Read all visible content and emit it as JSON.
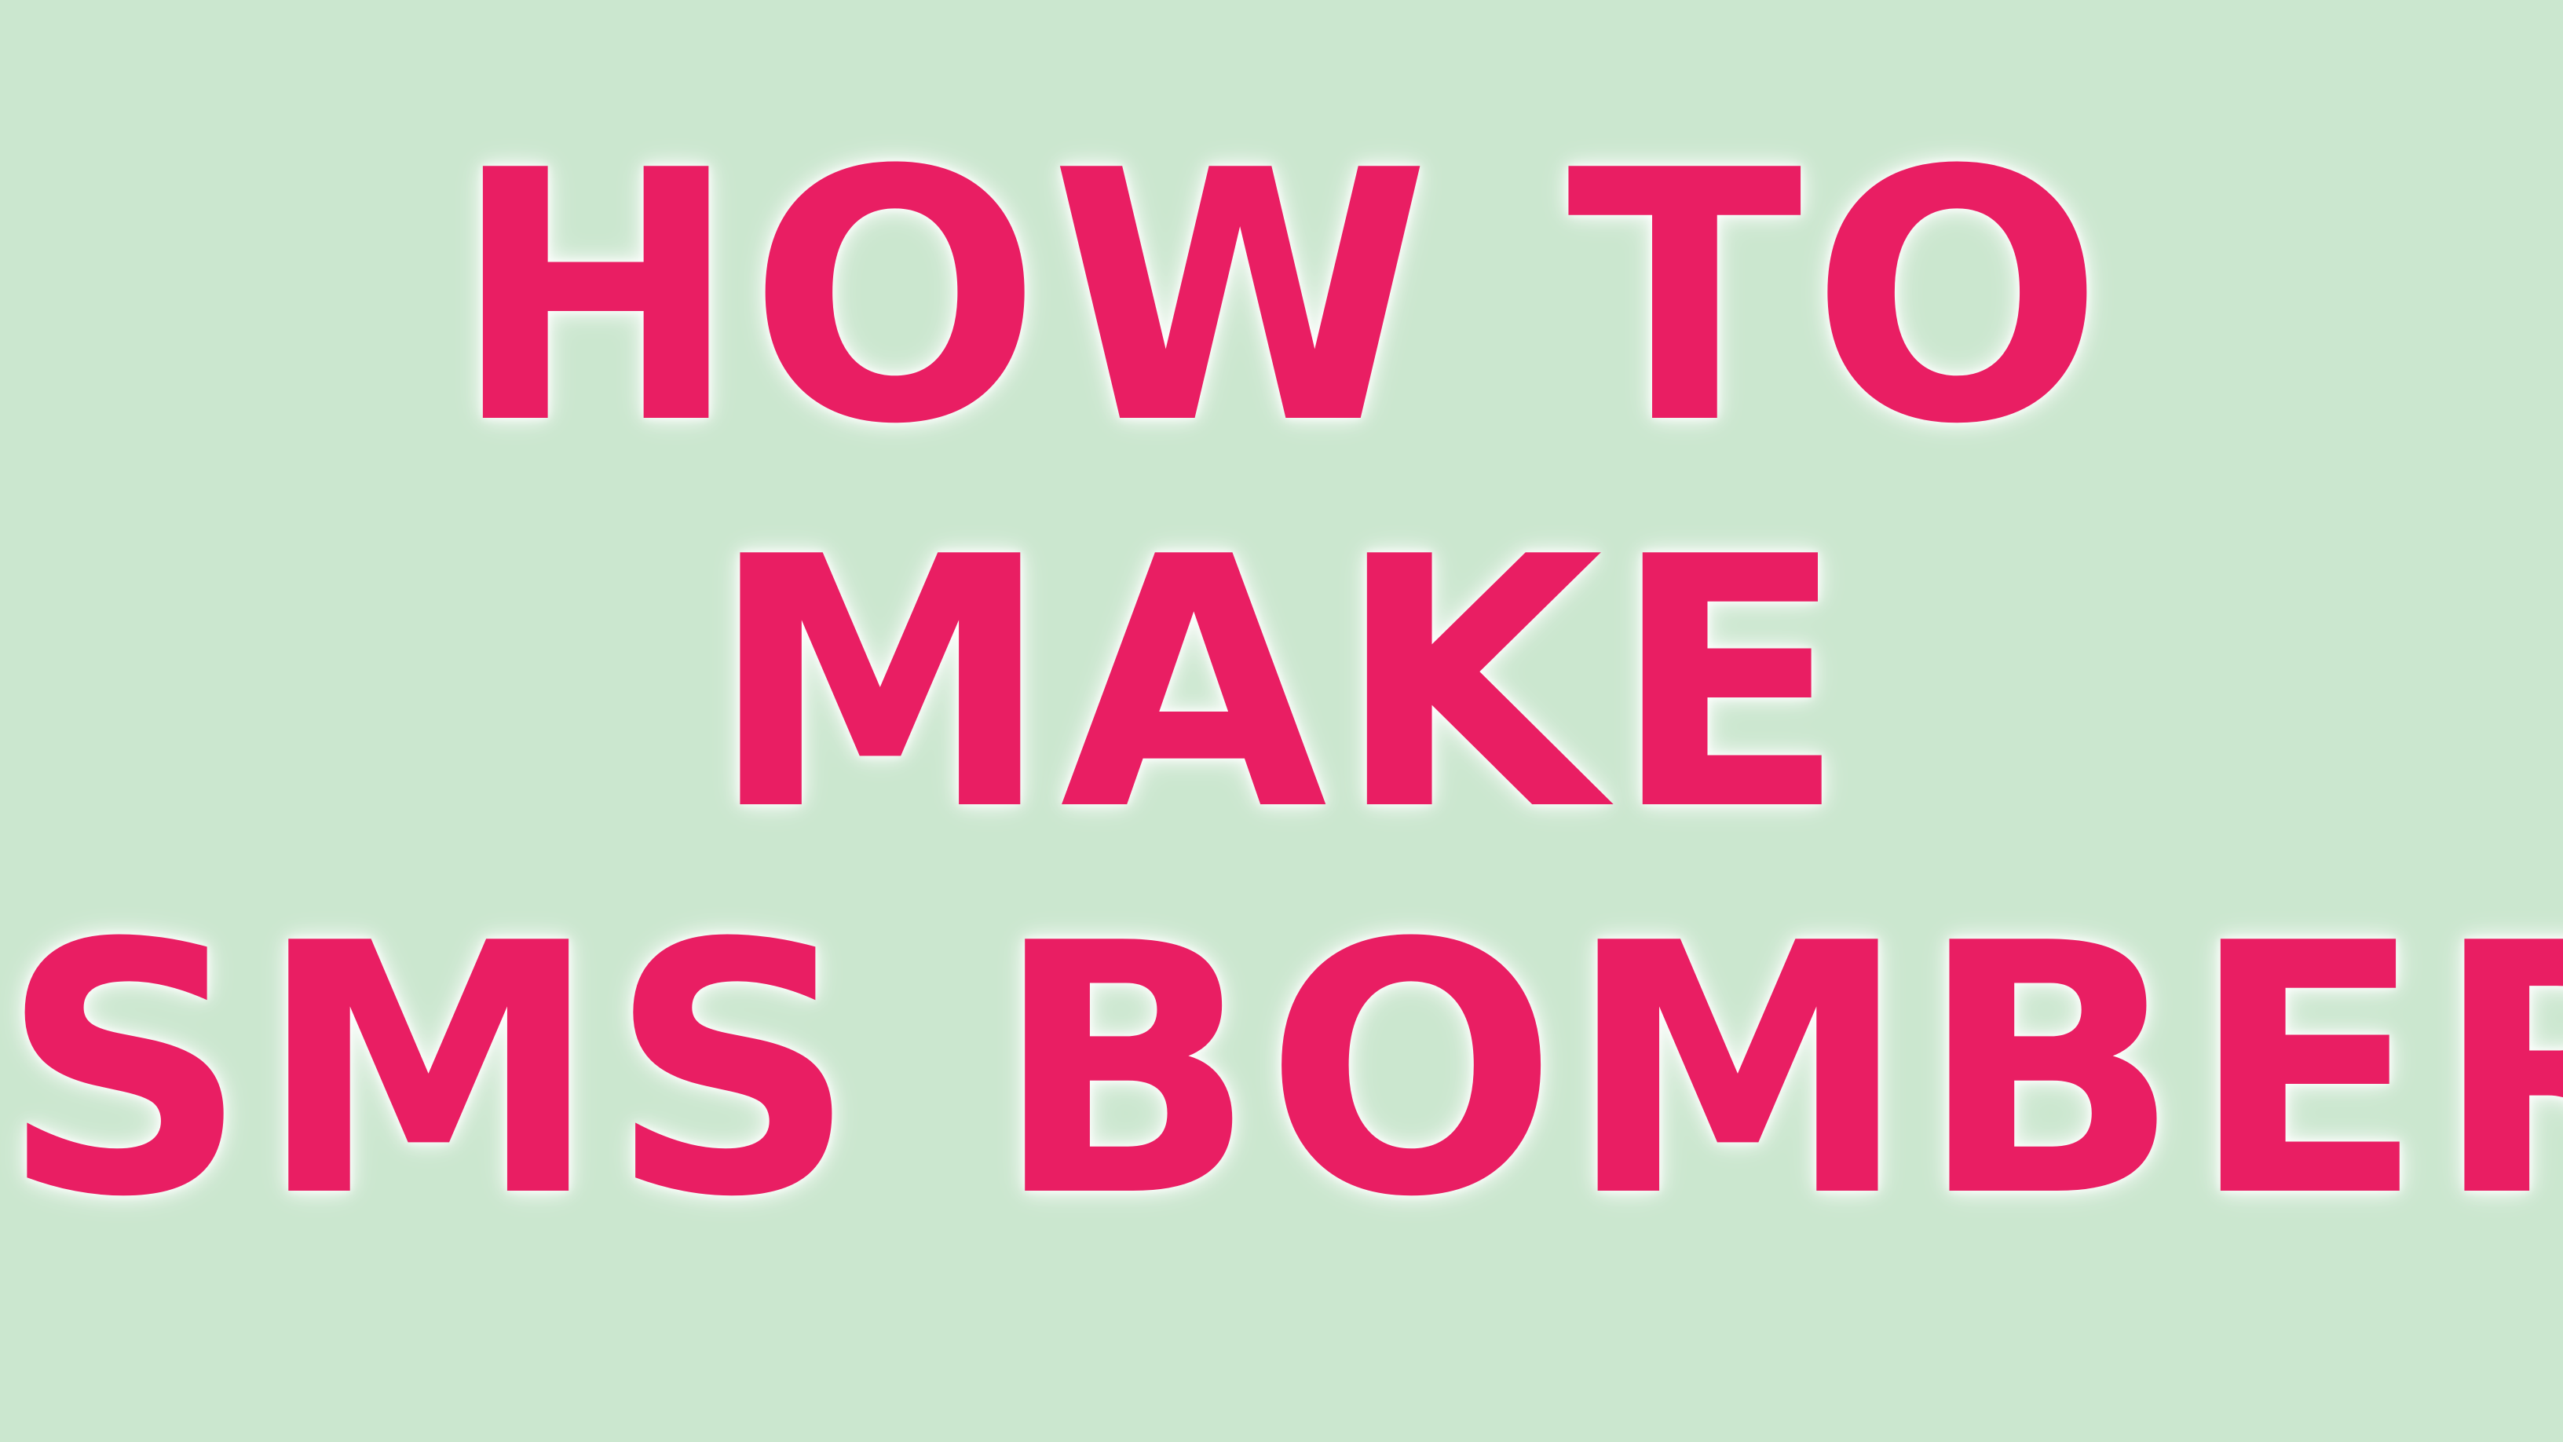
{
  "colors": {
    "background": "#cbe7cf",
    "text": "#e91e63",
    "glow": "#ffffff"
  },
  "title": {
    "line1": "HOW TO",
    "line2": "MAKE",
    "line3": "SMS BOMBER"
  }
}
